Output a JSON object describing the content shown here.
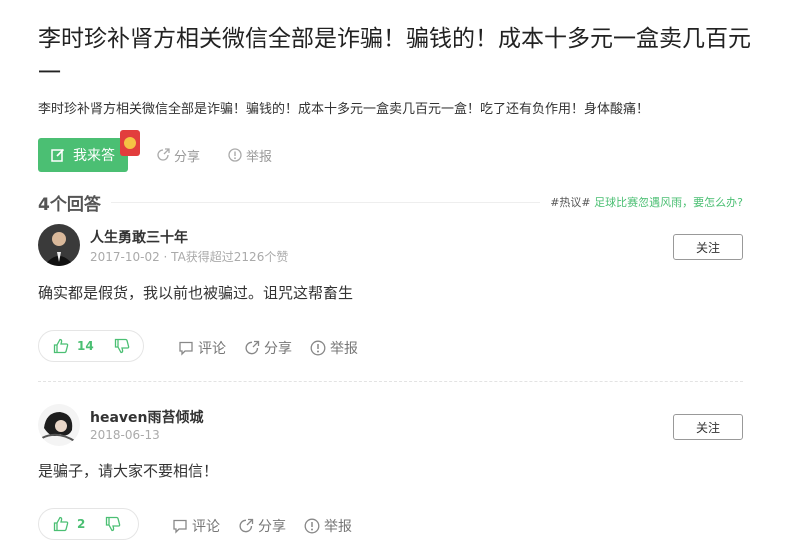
{
  "question": {
    "title": "李时珍补肾方相关微信全部是诈骗！骗钱的！成本十多元一盒卖几百元一",
    "description": "李时珍补肾方相关微信全部是诈骗！骗钱的！成本十多元一盒卖几百元一盒！吃了还有负作用！身体酸痛！",
    "answer_label": "我来答",
    "share_label": "分享",
    "report_label": "举报"
  },
  "answers_header": {
    "count_label": "4个回答",
    "hot_tag": "#热议#",
    "hot_question": "足球比赛忽遇风雨，要怎么办?"
  },
  "answers": [
    {
      "user": "人生勇敢三十年",
      "meta": "2017-10-02 · TA获得超过2126个赞",
      "follow_label": "关注",
      "content": "确实都是假货，我以前也被骗过。诅咒这帮畜生",
      "likes": "14",
      "comment_label": "评论",
      "share_label": "分享",
      "report_label": "举报"
    },
    {
      "user": "heaven雨苔倾城",
      "meta": "2018-06-13",
      "follow_label": "关注",
      "content": "是骗子，请大家不要相信！",
      "likes": "2",
      "comment_label": "评论",
      "share_label": "分享",
      "report_label": "举报"
    }
  ],
  "colors": {
    "accent": "#4bbf73",
    "redpacket": "#e23d3d"
  }
}
